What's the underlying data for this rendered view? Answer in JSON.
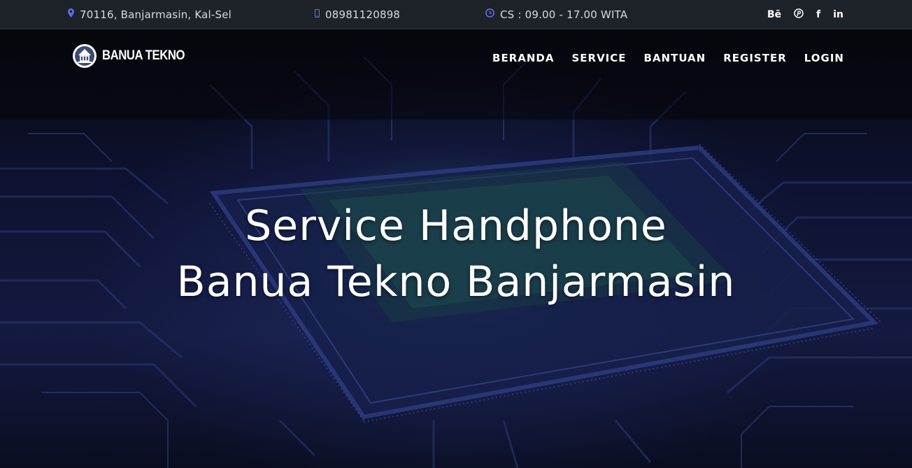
{
  "topbar": {
    "address": "70116, Banjarmasin, Kal-Sel",
    "phone": "08981120898",
    "hours": "CS : 09.00 - 17.00 WITA",
    "socials": [
      {
        "label": "Bē",
        "icon": "behance-icon"
      },
      {
        "label": "℗",
        "icon": "pinterest-icon"
      },
      {
        "label": "f",
        "icon": "facebook-icon"
      },
      {
        "label": "in",
        "icon": "linkedin-icon"
      }
    ],
    "accent_color": "#5a6ee8"
  },
  "brand": {
    "name": "BANUA TEKNO"
  },
  "nav": {
    "items": [
      "BERANDA",
      "SERVICE",
      "BANTUAN",
      "REGISTER",
      "LOGIN"
    ]
  },
  "hero": {
    "line1": "Service Handphone",
    "line2": "Banua Tekno Banjarmasin"
  }
}
